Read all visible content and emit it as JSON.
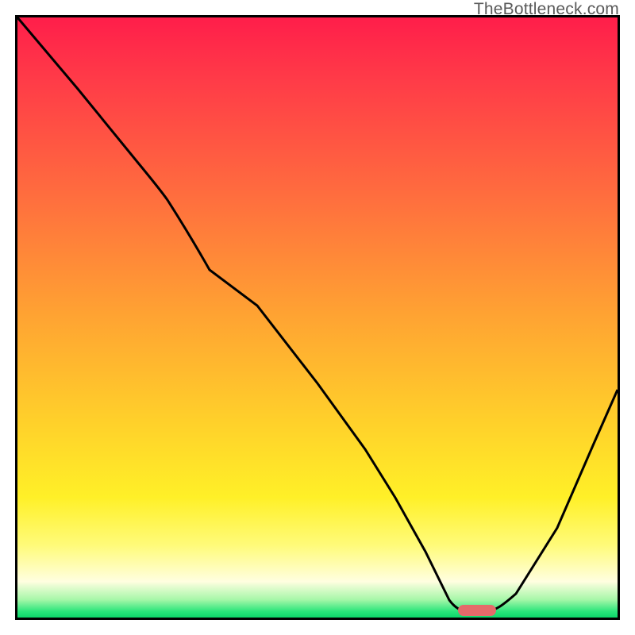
{
  "watermark": "TheBottleneck.com",
  "chart_data": {
    "type": "line",
    "title": "",
    "xlabel": "",
    "ylabel": "",
    "ylim": [
      0,
      100
    ],
    "xlim": [
      0,
      100
    ],
    "note": "Axes are unlabeled; values are estimated fractions of plot span (0–100). One black curve over a vertical heat gradient (red=high mismatch → green=optimal). A small salmon marker sits near the curve minimum.",
    "series": [
      {
        "name": "bottleneck-curve",
        "x": [
          0,
          10,
          20,
          25,
          32,
          40,
          50,
          58,
          63,
          68,
          72,
          75,
          78,
          83,
          90,
          96,
          100
        ],
        "y": [
          100,
          88,
          76,
          70,
          62,
          52,
          39,
          28,
          20,
          11,
          3,
          1,
          1,
          4,
          15,
          29,
          38
        ]
      }
    ],
    "marker": {
      "name": "optimal-point",
      "x": 76,
      "y": 1.2,
      "color": "#e66a6a"
    },
    "gradient_stops": [
      {
        "pos": 0.0,
        "color": "#ff1e4a"
      },
      {
        "pos": 0.3,
        "color": "#ff6e3e"
      },
      {
        "pos": 0.68,
        "color": "#ffd22a"
      },
      {
        "pos": 0.88,
        "color": "#fffb7a"
      },
      {
        "pos": 0.97,
        "color": "#a7f7a9"
      },
      {
        "pos": 1.0,
        "color": "#0dd66a"
      }
    ]
  }
}
